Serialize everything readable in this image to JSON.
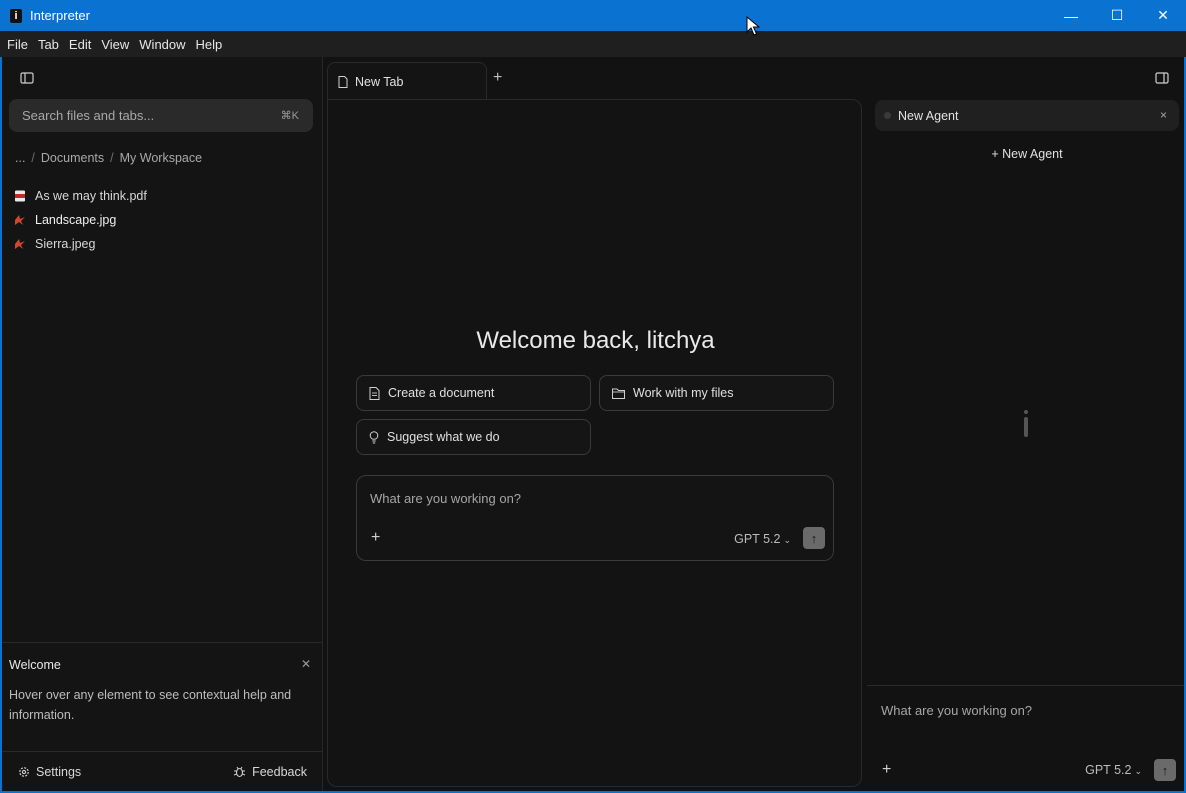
{
  "window": {
    "title": "Interpreter",
    "app_icon_glyph": "i",
    "controls": {
      "minimize": "—",
      "maximize": "☐",
      "close": "✕"
    }
  },
  "menubar": {
    "items": [
      "File",
      "Tab",
      "Edit",
      "View",
      "Window",
      "Help"
    ]
  },
  "sidebar": {
    "search_placeholder": "Search files and tabs...",
    "search_shortcut": "⌘K",
    "breadcrumb": [
      "...",
      "Documents",
      "My Workspace"
    ],
    "breadcrumb_sep": "/",
    "files": [
      {
        "name": "As we may think.pdf",
        "icon": "pdf-icon"
      },
      {
        "name": "Landscape.jpg",
        "icon": "image-icon"
      },
      {
        "name": "Sierra.jpeg",
        "icon": "image-icon"
      }
    ],
    "welcome": {
      "title": "Welcome",
      "text": "Hover over any element to see contextual help and information."
    },
    "footer": {
      "settings": "Settings",
      "feedback": "Feedback"
    }
  },
  "tabs": {
    "items": [
      {
        "label": "New Tab"
      }
    ],
    "add": "+"
  },
  "main": {
    "heading": "Welcome back, litchya",
    "actions": {
      "create_document": "Create a document",
      "work_with_files": "Work with my files",
      "suggest": "Suggest what we do"
    },
    "prompt": {
      "placeholder": "What are you working on?",
      "plus": "+",
      "model": "GPT 5.2",
      "send": "↑"
    }
  },
  "agent_panel": {
    "header_title": "New Agent",
    "close": "×",
    "new_agent_label": "+ New Agent",
    "prompt": {
      "placeholder": "What are you working on?",
      "plus": "+",
      "model": "GPT 5.2",
      "send": "↑"
    }
  },
  "colors": {
    "accent": "#0a73d1",
    "background": "#121212",
    "panel": "#141414"
  }
}
